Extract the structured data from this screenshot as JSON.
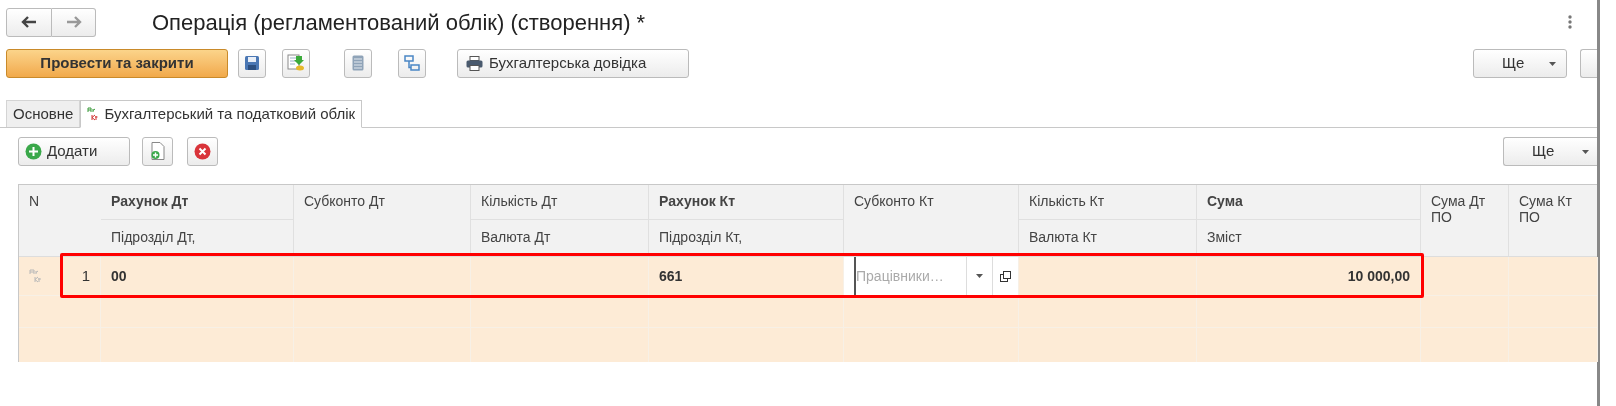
{
  "window": {
    "title": "Операція (регламентований облік) (створення) *"
  },
  "toolbar": {
    "primary_button": "Провести та закрити",
    "report_button": "Бухгалтерська довідка",
    "more_button": "Ще"
  },
  "tabs": [
    {
      "label": "Основне",
      "selected": false,
      "kind": "plain"
    },
    {
      "label": "Бухгалтерський та податковий облік",
      "selected": true,
      "kind": "entries"
    }
  ],
  "table_toolbar": {
    "add_button": "Додати",
    "more_button": "Ще"
  },
  "table": {
    "columns": [
      {
        "top": "N",
        "bold": false
      },
      {
        "top": "Рахунок Дт",
        "bottom": "Підрозділ Дт,",
        "bold": true
      },
      {
        "top": "Субконто Дт",
        "bold": false
      },
      {
        "top": "Кількість Дт",
        "bottom": "Валюта Дт",
        "bold": false
      },
      {
        "top": "Рахунок Кт",
        "bottom": "Підрозділ Кт,",
        "bold": true
      },
      {
        "top": "Субконто Кт",
        "bold": false
      },
      {
        "top": "Кількість Кт",
        "bottom": "Валюта Кт",
        "bold": false
      },
      {
        "top": "Сума",
        "bottom": "Зміст",
        "bold": true
      },
      {
        "top": "Сума Дт ПО",
        "bold": false
      },
      {
        "top": "Сума Кт ПО",
        "bold": false
      }
    ],
    "rows": [
      {
        "number": "1",
        "highlighted": true,
        "account_dt": "00",
        "account_kt": "661",
        "subconto_kt_placeholder": "Працівники…",
        "amount": "10 000,00"
      }
    ]
  }
}
